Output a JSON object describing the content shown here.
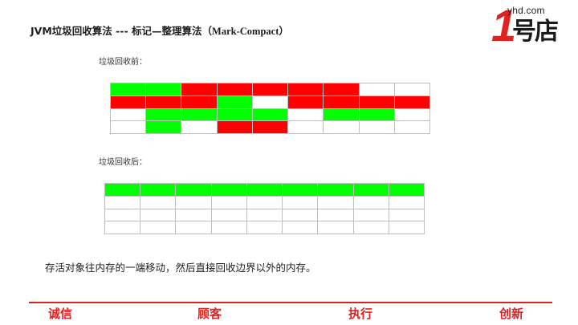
{
  "title": {
    "main": "JVM垃圾回收算法 --- 标记—整理算法（",
    "algo": "Mark-Compact",
    "close": "）"
  },
  "logo": {
    "domain": "yhd.com",
    "digit": "1",
    "name": "号店"
  },
  "colors": {
    "live": "#00ff00",
    "garbage": "#ff0000",
    "free": "#ffffff",
    "accent": "#e02020"
  },
  "before": {
    "caption": "垃圾回收前：",
    "rows": [
      [
        "g",
        "g",
        "r",
        "r",
        "r",
        "r",
        "r",
        "w",
        "w"
      ],
      [
        "r",
        "r",
        "r",
        "g",
        "w",
        "r",
        "r",
        "r",
        "r"
      ],
      [
        "w",
        "g",
        "g",
        "g",
        "g",
        "w",
        "g",
        "g",
        "w"
      ],
      [
        "w",
        "g",
        "w",
        "r",
        "r",
        "w",
        "w",
        "w",
        "w"
      ]
    ]
  },
  "after": {
    "caption": "垃圾回收后：",
    "rows": [
      [
        "g",
        "g",
        "g",
        "g",
        "g",
        "g",
        "g",
        "g",
        "g"
      ],
      [
        "w",
        "w",
        "w",
        "w",
        "w",
        "w",
        "w",
        "w",
        "w"
      ],
      [
        "w",
        "w",
        "w",
        "w",
        "w",
        "w",
        "w",
        "w",
        "w"
      ],
      [
        "w",
        "w",
        "w",
        "w",
        "w",
        "w",
        "w",
        "w",
        "w"
      ]
    ]
  },
  "summary": "存活对象往内存的一端移动，然后直接回收边界以外的内存。",
  "footer": [
    "诚信",
    "顾客",
    "执行",
    "创新"
  ]
}
